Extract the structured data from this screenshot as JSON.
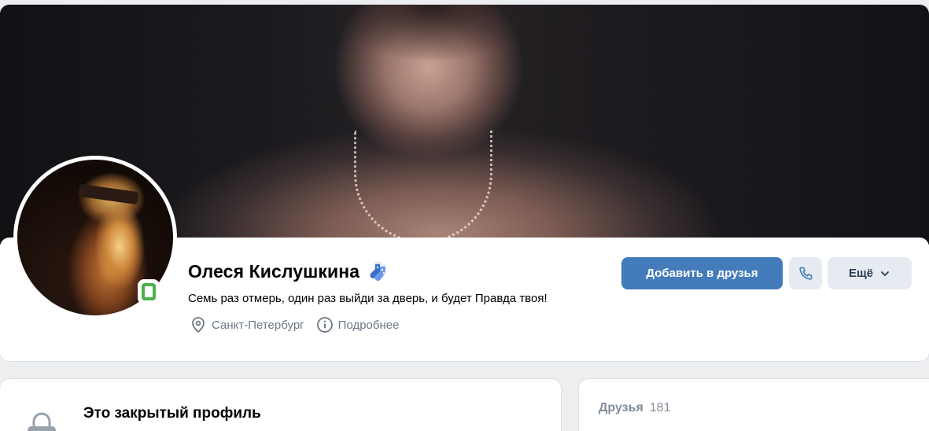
{
  "profile": {
    "name": "Олеся Кислушкина",
    "status": "Семь раз отмерь, один раз выйди за дверь, и будет Правда твоя!",
    "city": "Санкт-Петербург",
    "details_link": "Подробнее",
    "online_indicator": "mobile",
    "status_emoji": "socks-icon"
  },
  "actions": {
    "add_friend_label": "Добавить в друзья",
    "call_icon": "phone-icon",
    "more_label": "Ещё",
    "more_icon": "chevron-down-icon"
  },
  "closed_profile": {
    "title": "Это закрытый профиль",
    "icon": "lock-icon"
  },
  "friends": {
    "label": "Друзья",
    "count": "181"
  },
  "colors": {
    "accent": "#447bba",
    "secondary_button": "#e5ebf1",
    "online": "#4bb34b",
    "meta_text": "#6d7885",
    "background": "#edeef0"
  }
}
